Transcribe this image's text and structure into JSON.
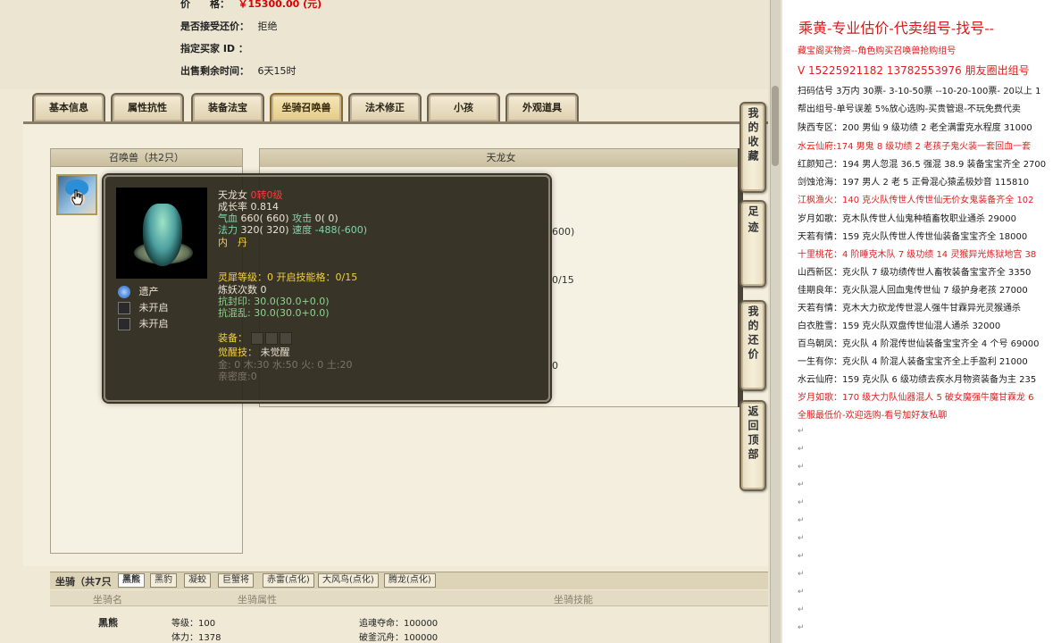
{
  "listing": {
    "price_label": "价　　格：",
    "price_value": "￥15300.00 (元)",
    "accept_counter_label": "是否接受还价：",
    "accept_counter_value": "拒绝",
    "buyer_label": "指定买家 ID ：",
    "buyer_value": "",
    "time_left_label": "出售剩余时间：",
    "time_left_value": "6天15时"
  },
  "tabs": [
    {
      "label": "基本信息"
    },
    {
      "label": "属性抗性"
    },
    {
      "label": "装备法宝"
    },
    {
      "label": "坐骑召唤兽",
      "active": true
    },
    {
      "label": "法术修正"
    },
    {
      "label": "小孩"
    },
    {
      "label": "外观道具"
    }
  ],
  "summon_panel": {
    "header": "召唤兽（共2只）"
  },
  "detail_panel": {
    "header": "天龙女",
    "value_a": "600)",
    "value_b": "0/15",
    "value_c": "0"
  },
  "tooltip": {
    "name": "天龙女",
    "grade": "0转0级",
    "growth": "成长率 0.814",
    "hp_label": "气血",
    "hp": "660( 660)",
    "atk_label": "攻击",
    "atk": "0( 0)",
    "mp_label": "法力",
    "mp": "320( 320)",
    "spd_label": "速度",
    "spd": "-488(-600)",
    "inner_label": "内　丹",
    "skills": [
      {
        "icon": "blue-orb-icon",
        "label": "遗产"
      },
      {
        "icon": "locked-slot-icon",
        "label": "未开启"
      },
      {
        "icon": "locked-slot-icon",
        "label": "未开启"
      }
    ],
    "spirit_line": "灵犀等级：0 开启技能格：0/15",
    "refine_line": "炼妖次数 0",
    "seal_line": "抗封印: 30.0(30.0+0.0)",
    "chaos_line": "抗混乱: 30.0(30.0+0.0)",
    "equip_label": "装备：",
    "awaken_label": "觉醒技：",
    "awaken_value": "未觉醒",
    "elements_line": "金: 0 木:30 水:50 火: 0 土:20",
    "intimacy_line": "亲密度:0"
  },
  "side_buttons": [
    {
      "label": "我的收藏"
    },
    {
      "label": "足迹"
    },
    {
      "label": "我的还价"
    },
    {
      "label": "返回顶部"
    }
  ],
  "mounts": {
    "header": "坐骑（共7只",
    "tabs": [
      "黑熊",
      "黑豹",
      "凝蛟",
      "巨蟹将",
      "赤雷(点化)",
      "大风鸟(点化)",
      "腾龙(点化)"
    ],
    "col_name": "坐骑名",
    "col_attr": "坐骑属性",
    "col_skill": "坐骑技能",
    "row_name": "黑熊",
    "level": "等级：100",
    "stamina": "体力：1378",
    "skill1": "追魂夺命：100000",
    "skill2": "破釜沉舟：100000"
  },
  "right_panel": {
    "title": "乘黄-专业估价-代卖组号-找号--",
    "lines": [
      {
        "text": "藏宝阁买物资--角色购买召唤兽抢购组号",
        "style": "red"
      },
      {
        "text": "V 15225921182   13782553976 朋友圈出组号",
        "style": "big"
      },
      {
        "text": "扫码估号 3万内 30票- 3-10-50票 --10-20-100票- 20以上 1",
        "style": ""
      },
      {
        "text": "帮出组号-单号误差 5%放心选购-买贵管退-不玩免费代卖",
        "style": ""
      },
      {
        "text": "陕西专区：200 男仙 9 级功绩 2 老全满雷克水程度 31000",
        "style": ""
      },
      {
        "text": "水云仙府:174 男鬼 8 级功绩 2 老孩子鬼火装一套回血一套",
        "style": "red"
      },
      {
        "text": "红颜知己：194 男人忽混 36.5 强混 38.9 装备宝宝齐全 2700",
        "style": ""
      },
      {
        "text": "剑蚀沧海：197 男人 2 老 5 正骨混心猿孟极妙音 115810",
        "style": ""
      },
      {
        "text": "江枫渔火：140 克火队传世人传世仙无价女鬼装备齐全 102",
        "style": "red"
      },
      {
        "text": "岁月如歌：克木队传世人仙鬼种植畜牧职业通杀 29000",
        "style": ""
      },
      {
        "text": "天若有情：159 克火队传世人传世仙装备宝宝齐全 18000",
        "style": ""
      },
      {
        "text": "十里桃花：4 阶睡克木队 7 级功绩 14 灵猴异光炼狱地宫 38",
        "style": "red"
      },
      {
        "text": "山西新区：克火队 7 级功绩传世人畜牧装备宝宝齐全 3350",
        "style": ""
      },
      {
        "text": "佳期良年：克火队混人回血鬼传世仙 7 级护身老孩 27000",
        "style": ""
      },
      {
        "text": "天若有情：克木大力砍龙传世混人强牛甘霖异光灵猴通杀",
        "style": ""
      },
      {
        "text": "白衣胜雪：159 克火队双盘传世仙混人通杀 32000",
        "style": ""
      },
      {
        "text": "百鸟朝凤：克火队 4 阶混传世仙装备宝宝齐全 4 个号 69000",
        "style": ""
      },
      {
        "text": "一生有你：克火队 4 阶混人装备宝宝齐全上手盈利 21000",
        "style": ""
      },
      {
        "text": "水云仙府：159 克火队 6 级功绩去疾水月物资装备为主 235",
        "style": ""
      },
      {
        "text": "岁月如歌：170 级大力队仙器混人 5 破女魔强牛魔甘霖龙 6",
        "style": "red"
      },
      {
        "text": "全服最低价-欢迎选购-看号加好友私聊",
        "style": "red"
      }
    ]
  },
  "colors": {
    "accent_red": "#d81a1a",
    "tooltip_bg": "#282418",
    "tab_bg": "#ddd0ad"
  }
}
